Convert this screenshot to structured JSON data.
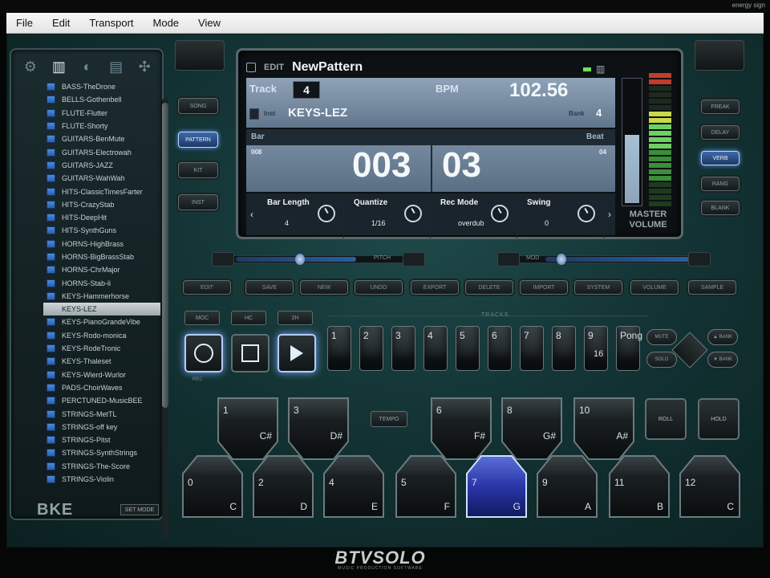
{
  "menu": [
    "File",
    "Edit",
    "Transport",
    "Mode",
    "View"
  ],
  "system": {
    "info": "energy sign"
  },
  "browser": {
    "tabs": [
      "settings-tab",
      "keys-tab",
      "drums-tab",
      "mixer-tab",
      "fx-tab"
    ],
    "items": [
      "BASS-TheDrone",
      "BELLS-Gothenbell",
      "FLUTE-Flutter",
      "FLUTE-Shorty",
      "GUITARS-BenMute",
      "GUITARS-Electrowah",
      "GUITARS-JAZZ",
      "GUITARS-WahWah",
      "HITS-ClassicTimesFarter",
      "HITS-CrazyStab",
      "HITS-DeepHit",
      "HITS-SynthGuns",
      "HORNS-HighBrass",
      "HORNS-BigBrassStab",
      "HORNS-ChrMajor",
      "HORNS-Stab-li",
      "KEYS-Hammerhorse",
      "KEYS-LEZ",
      "KEYS-PianoGrandeVibe",
      "KEYS-Rodo-monica",
      "KEYS-RodeTronic",
      "KEYS-Thaleset",
      "KEYS-Wierd-Wurlor",
      "PADS-ChoirWaves",
      "PERCTUNED-MusicBEE",
      "STRINGS-MetTL",
      "STRINGS-off key",
      "STRINGS-Pitst",
      "STRINGS-SynthStrings",
      "STRINGS-The-Score",
      "STRINGS-Violin"
    ],
    "selected_index": 17,
    "logo": "BKE",
    "set_mode": "SET MODE"
  },
  "mode_buttons": [
    "SONG",
    "PATTERN",
    "KIT",
    "INST"
  ],
  "active_mode": "PATTERN",
  "lcd": {
    "edit_label": "EDIT",
    "pattern_name": "NewPattern",
    "track_label": "Track",
    "track": "4",
    "bpm_label": "BPM",
    "bpm": "102.56",
    "inst_label": "Inst",
    "inst": "KEYS-LEZ",
    "bank_label": "Bank",
    "bank": "4",
    "bar_label": "Bar",
    "beat_label": "Beat",
    "bar_total": "008",
    "bar": "003",
    "beat": "03",
    "beat_total": "04",
    "knobs": [
      {
        "label": "Bar Length",
        "value": "4"
      },
      {
        "label": "Quantize",
        "value": "1/16"
      },
      {
        "label": "Rec Mode",
        "value": "overdub"
      },
      {
        "label": "Swing",
        "value": "0"
      }
    ],
    "volume_label": "MASTER VOLUME",
    "volume_level": 0.55
  },
  "fx_buttons": [
    "FREAK",
    "DELAY",
    "VERB",
    "RANG",
    "BLANK"
  ],
  "active_fx": "VERB",
  "sliders": [
    {
      "label": "PITCH",
      "value": 0.35
    },
    {
      "label": "MOD",
      "value": 0.3
    }
  ],
  "function_buttons": [
    "EDIT",
    "SAVE",
    "NEW",
    "UNDO",
    "EXPORT",
    "DELETE",
    "IMPORT",
    "SYSTEM",
    "VOLUME",
    "SAMPLE"
  ],
  "small_buttons": [
    "MOC",
    "HC",
    "2H"
  ],
  "tracks_label": "TRACKS",
  "transport": {
    "record": "record",
    "stop": "stop",
    "play": "play",
    "record_label": "REC"
  },
  "track_buttons": [
    {
      "n": "1"
    },
    {
      "n": "2"
    },
    {
      "n": "3"
    },
    {
      "n": "4"
    },
    {
      "n": "5"
    },
    {
      "n": "6"
    },
    {
      "n": "7"
    },
    {
      "n": "8"
    },
    {
      "n": "9",
      "sub": "16"
    },
    {
      "n": "Pong"
    }
  ],
  "nav_buttons": {
    "mute": "MUTE",
    "solo": "SOLO",
    "bank": "BANK",
    "bank_up": "▲ BANK",
    "bank_down": "▼ BANK"
  },
  "pads_top": [
    {
      "n": "1",
      "note": "C#"
    },
    {
      "n": "3",
      "note": "D#"
    },
    {
      "n": "6",
      "note": "F#"
    },
    {
      "n": "8",
      "note": "G#"
    },
    {
      "n": "10",
      "note": "A#"
    }
  ],
  "pads_bottom": [
    {
      "n": "0",
      "note": "C"
    },
    {
      "n": "2",
      "note": "D"
    },
    {
      "n": "4",
      "note": "E"
    },
    {
      "n": "5",
      "note": "F"
    },
    {
      "n": "7",
      "note": "G"
    },
    {
      "n": "9",
      "note": "A"
    },
    {
      "n": "11",
      "note": "B"
    },
    {
      "n": "12",
      "note": "C"
    }
  ],
  "active_pad": "7",
  "temp_button": "TEMPO",
  "roll_button": "ROLL",
  "hold_button": "HOLD",
  "brand": {
    "name": "BTVSOLO",
    "sub": "MUSIC PRODUCTION SOFTWARE"
  }
}
